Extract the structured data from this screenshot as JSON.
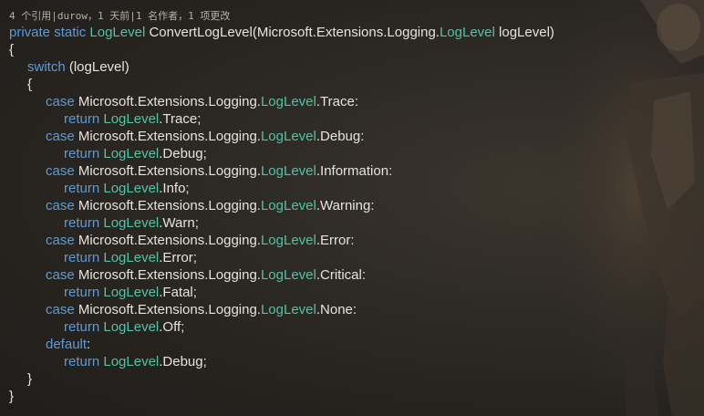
{
  "codelens": "4 个引用|durow，1 天前|1 名作者，1 项更改",
  "signature": {
    "private_kw": "private",
    "static_kw": "static",
    "return_type": "LogLevel",
    "method_name": "ConvertLogLevel(",
    "param_namespace": "Microsoft.Extensions.Logging.",
    "param_type": "LogLevel",
    "param_name": " logLevel)"
  },
  "braces": {
    "open": "{",
    "close": "}"
  },
  "switch_stmt": {
    "keyword": "switch",
    "expr": " (logLevel)"
  },
  "keywords": {
    "case": "case",
    "return": "return",
    "default": "default"
  },
  "namespace": "Microsoft.Extensions.Logging.",
  "enum_type": "LogLevel",
  "cases": [
    {
      "from": ".Trace:",
      "to": ".Trace;"
    },
    {
      "from": ".Debug:",
      "to": ".Debug;"
    },
    {
      "from": ".Information:",
      "to": ".Info;"
    },
    {
      "from": ".Warning:",
      "to": ".Warn;"
    },
    {
      "from": ".Error:",
      "to": ".Error;"
    },
    {
      "from": ".Critical:",
      "to": ".Fatal;"
    },
    {
      "from": ".None:",
      "to": ".Off;"
    }
  ],
  "default_case": {
    "colon": ":",
    "to": ".Debug;"
  },
  "colors": {
    "keyword": "#5b9bd8",
    "type": "#52c3a6",
    "text": "#e6e3dc",
    "codelens": "#b4b0a8",
    "background": "#2b2824"
  }
}
